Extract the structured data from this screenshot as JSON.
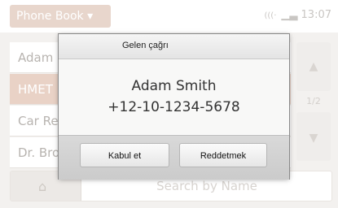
{
  "topbar": {
    "phonebook_label": "Phone Book ▾",
    "network": "(((·",
    "signal": "▁▃",
    "time": "13:07"
  },
  "contacts": [
    {
      "name": "Adam",
      "selected": false
    },
    {
      "name": "HMET",
      "selected": true
    },
    {
      "name": "Car Re",
      "selected": false
    },
    {
      "name": "Dr. Bro",
      "selected": false
    }
  ],
  "pager": {
    "up": "▲",
    "page": "1/2",
    "down": "▼"
  },
  "bottom": {
    "home_icon": "home-icon",
    "search_placeholder": "Search by Name"
  },
  "dialog": {
    "title": "Gelen çağrı",
    "caller_name": "Adam Smith",
    "caller_number": "+12-10-1234-5678",
    "accept_label": "Kabul et",
    "reject_label": "Reddetmek"
  },
  "colors": {
    "accent": "#e9d2c6",
    "background": "#f3f1ef"
  }
}
